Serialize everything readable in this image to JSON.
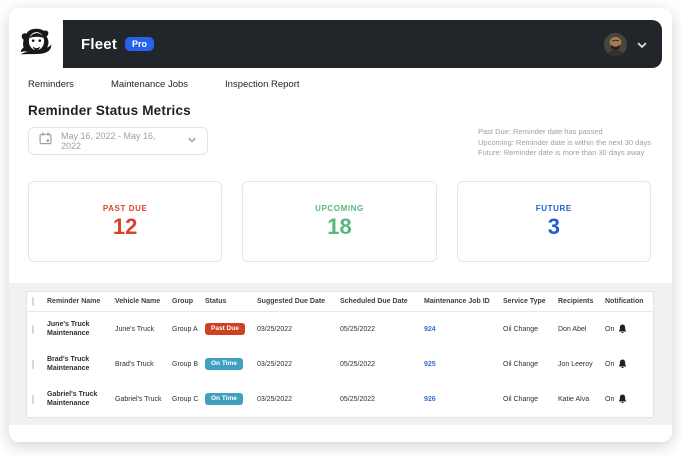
{
  "header": {
    "brand": "Fleet",
    "badge": "Pro"
  },
  "nav": {
    "items": [
      {
        "label": "Reminders"
      },
      {
        "label": "Maintenance Jobs"
      },
      {
        "label": "Inspection Report"
      }
    ]
  },
  "page": {
    "title": "Reminder Status Metrics",
    "date_range": "May 16, 2022 - May 16, 2022",
    "legend": [
      "Past Due: Reminder date has passed",
      "Upcoming: Reminder date is within the next 30 days",
      "Future: Reminder date is more than 30 days away"
    ]
  },
  "metrics": [
    {
      "label": "PAST DUE",
      "value": "12",
      "color": "#d9432b"
    },
    {
      "label": "UPCOMING",
      "value": "18",
      "color": "#56b87c"
    },
    {
      "label": "FUTURE",
      "value": "3",
      "color": "#1f5fd6"
    }
  ],
  "table": {
    "columns": {
      "reminder_name": "Reminder Name",
      "vehicle_name": "Vehicle Name",
      "group": "Group",
      "status": "Status",
      "suggested_due_date": "Suggested Due Date",
      "scheduled_due_date": "Scheduled Due Date",
      "maintenance_job_id": "Maintenance Job ID",
      "service_type": "Service Type",
      "recipients": "Recipients",
      "notification": "Notification"
    },
    "rows": [
      {
        "reminder_name": "June's Truck Maintenance",
        "vehicle_name": "June's Truck",
        "group": "Group A",
        "status": "Past Due",
        "status_color": "#d04124",
        "suggested_due_date": "03/25/2022",
        "scheduled_due_date": "05/25/2022",
        "maintenance_job_id": "924",
        "service_type": "Oil Change",
        "recipients": "Don Abel",
        "notification": "On"
      },
      {
        "reminder_name": "Brad's Truck Maintenance",
        "vehicle_name": "Brad's Truck",
        "group": "Group B",
        "status": "On Time",
        "status_color": "#40a0bf",
        "suggested_due_date": "03/25/2022",
        "scheduled_due_date": "05/25/2022",
        "maintenance_job_id": "925",
        "service_type": "Oil Change",
        "recipients": "Jon Leeroy",
        "notification": "On"
      },
      {
        "reminder_name": "Gabriel's Truck Maintenance",
        "vehicle_name": "Gabriel's Truck",
        "group": "Group C",
        "status": "On Time",
        "status_color": "#40a0bf",
        "suggested_due_date": "03/25/2022",
        "scheduled_due_date": "05/25/2022",
        "maintenance_job_id": "926",
        "service_type": "Oil Change",
        "recipients": "Katie Alva",
        "notification": "On"
      }
    ]
  }
}
